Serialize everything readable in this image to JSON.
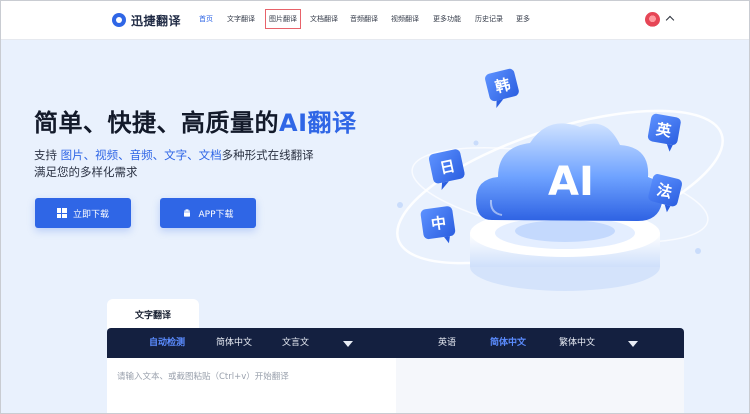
{
  "header": {
    "logo_text": "迅捷翻译",
    "nav": [
      {
        "label": "首页"
      },
      {
        "label": "文字翻译"
      },
      {
        "label": "图片翻译"
      },
      {
        "label": "文档翻译"
      },
      {
        "label": "音频翻译"
      },
      {
        "label": "视频翻译"
      },
      {
        "label": "更多功能"
      },
      {
        "label": "历史记录"
      },
      {
        "label": "更多"
      }
    ],
    "active_index": 0,
    "highlighted_index": 2
  },
  "hero": {
    "title_main": "简单、快捷、高质量的",
    "title_accent": "AI翻译",
    "sub_prefix": "支持 ",
    "sub_links": "图片、视频、音频、文字、文档",
    "sub_suffix": "多种形式在线翻译",
    "sub_line2": "满足您的多样化需求",
    "btn_download": "立即下载",
    "btn_app": "APP下载"
  },
  "illustration": {
    "cloud_text": "AI",
    "bubbles": [
      "韩",
      "英",
      "日",
      "法",
      "中"
    ]
  },
  "translator": {
    "tab_label": "文字翻译",
    "source_langs": [
      "自动检测",
      "简体中文",
      "文言文"
    ],
    "target_langs": [
      "英语",
      "简体中文",
      "繁体中文"
    ],
    "placeholder": "请输入文本、或截图粘贴（Ctrl+v）开始翻译"
  },
  "colors": {
    "brand": "#2f66e6",
    "bar_dark": "#142040",
    "selected_lang": "#5b8cff",
    "highlight_box": "#e8626a"
  }
}
